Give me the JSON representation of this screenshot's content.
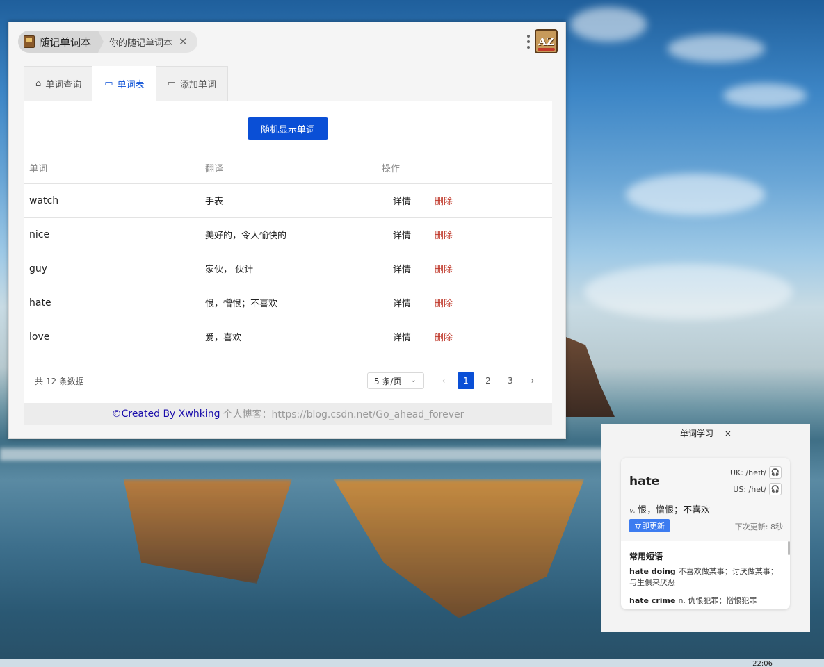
{
  "window": {
    "app_title": "随记单词本",
    "subtitle": "你的随记单词本",
    "close_glyph": "✕",
    "app_icon_text": "AZ"
  },
  "tabs": [
    {
      "label": "单词查询",
      "icon": "home-icon"
    },
    {
      "label": "单词表",
      "icon": "calendar-icon",
      "active": true
    },
    {
      "label": "添加单词",
      "icon": "calendar-icon"
    }
  ],
  "random_button": "随机显示单词",
  "table": {
    "headers": [
      "单词",
      "翻译",
      "操作"
    ],
    "rows": [
      {
        "word": "watch",
        "translation": "手表",
        "detail": "详情",
        "delete": "删除"
      },
      {
        "word": "nice",
        "translation": "美好的，令人愉快的",
        "detail": "详情",
        "delete": "删除"
      },
      {
        "word": "guy",
        "translation": "家伙， 伙计",
        "detail": "详情",
        "delete": "删除"
      },
      {
        "word": "hate",
        "translation": "恨，憎恨；不喜欢",
        "detail": "详情",
        "delete": "删除"
      },
      {
        "word": "love",
        "translation": "爱，喜欢",
        "detail": "详情",
        "delete": "删除"
      }
    ]
  },
  "pagination": {
    "total": "共 12 条数据",
    "page_size": "5 条/页",
    "pages": [
      "1",
      "2",
      "3"
    ],
    "current": "1",
    "prev": "‹",
    "next": "›"
  },
  "footer": {
    "credit": "©Created By Xwhking",
    "blog": "个人博客：https://blog.csdn.net/Go_ahead_forever"
  },
  "widget": {
    "title": "单词学习",
    "close": "×",
    "word": "hate",
    "uk": "UK: /heɪt/",
    "us": "US: /het/",
    "pos": "v.",
    "definition": "恨，憎恨；不喜欢",
    "update_button": "立即更新",
    "next_update": "下次更新: 8秒",
    "phrases_title": "常用短语",
    "phrases": [
      {
        "phrase": "hate doing",
        "meaning": "不喜欢做某事；讨厌做某事；与生俱来厌恶"
      },
      {
        "phrase": "hate crime",
        "meaning": "n. 仇恨犯罪；憎恨犯罪"
      }
    ]
  },
  "taskbar": {
    "clock": "22:06"
  }
}
